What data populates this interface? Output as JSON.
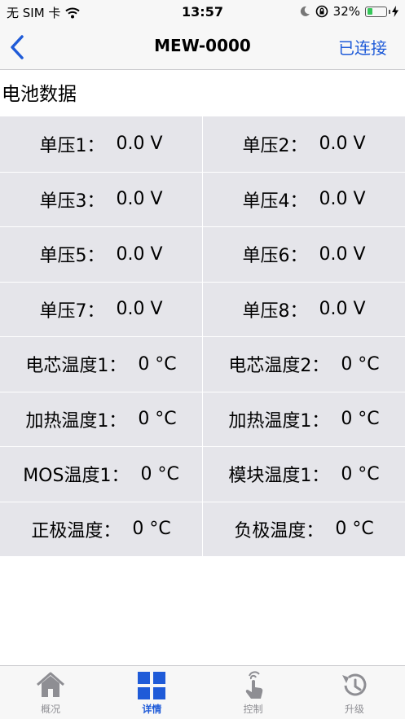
{
  "status_bar": {
    "carrier": "无 SIM 卡",
    "time": "13:57",
    "battery_percent": "32%",
    "battery_level": 0.32,
    "battery_color": "#35c759"
  },
  "nav": {
    "back_icon": "chevron-left-icon",
    "title": "MEW-0000",
    "status": "已连接",
    "accent_color": "#1f5bd8"
  },
  "section_title": "电池数据",
  "grid": [
    [
      {
        "label": "单压1：",
        "value": "0.0 V"
      },
      {
        "label": "单压2：",
        "value": "0.0 V"
      }
    ],
    [
      {
        "label": "单压3：",
        "value": "0.0 V"
      },
      {
        "label": "单压4：",
        "value": "0.0 V"
      }
    ],
    [
      {
        "label": "单压5：",
        "value": "0.0 V"
      },
      {
        "label": "单压6：",
        "value": "0.0 V"
      }
    ],
    [
      {
        "label": "单压7：",
        "value": "0.0 V"
      },
      {
        "label": "单压8：",
        "value": "0.0 V"
      }
    ],
    [
      {
        "label": "电芯温度1：",
        "value": "0 °C"
      },
      {
        "label": "电芯温度2：",
        "value": "0 °C"
      }
    ],
    [
      {
        "label": "加热温度1：",
        "value": "0 °C"
      },
      {
        "label": "加热温度1：",
        "value": "0 °C"
      }
    ],
    [
      {
        "label": "MOS温度1：",
        "value": "0 °C"
      },
      {
        "label": "模块温度1：",
        "value": "0 °C"
      }
    ],
    [
      {
        "label": "正极温度：",
        "value": "0 °C"
      },
      {
        "label": "负极温度：",
        "value": "0 °C"
      }
    ]
  ],
  "tabs": [
    {
      "label": "概况",
      "icon": "home-icon",
      "active": false
    },
    {
      "label": "详情",
      "icon": "grid-icon",
      "active": true
    },
    {
      "label": "控制",
      "icon": "touch-icon",
      "active": false
    },
    {
      "label": "升级",
      "icon": "history-icon",
      "active": false
    }
  ]
}
